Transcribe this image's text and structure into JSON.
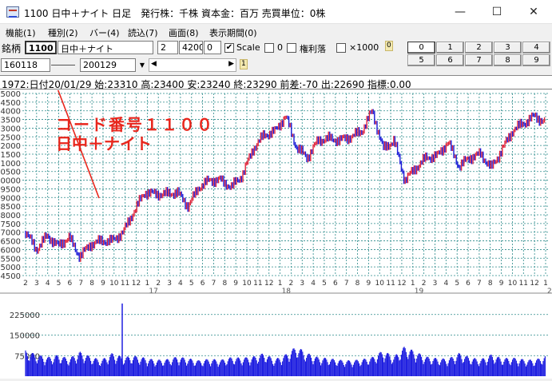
{
  "window": {
    "title": "1100 日中＋ナイト  日足　発行株：千株  資本金：百万  売買単位：0株",
    "minimize": "—",
    "maximize": "☐",
    "close": "✕"
  },
  "menu": [
    {
      "label": "機能(1)"
    },
    {
      "label": "種別(2)"
    },
    {
      "label": "バー(4)"
    },
    {
      "label": "読込(7)"
    },
    {
      "label": "画面(8)"
    },
    {
      "label": "表示期間(0)"
    }
  ],
  "toolbar": {
    "symbol_label": "銘柄",
    "code": "1100",
    "name": "日中＋ナイト",
    "field1": "2",
    "field2": "4200",
    "field3": "0",
    "scale_checked": "✔",
    "scale_label": "Scale",
    "zero_label": "0",
    "kenri_label": "権利落",
    "x1000_label": "×1000",
    "badge0": "0",
    "badge1": "1",
    "date_from": "160118",
    "date_to": "200129",
    "grid_buttons": [
      "0",
      "1",
      "2",
      "3",
      "4",
      "5",
      "6",
      "7",
      "8",
      "9"
    ],
    "grid_active": "0"
  },
  "info": {
    "text": "1972:日付20/01/29 始:23310 高:23400 安:23240 終:23290 前差:-70 出:22690 指標:0.00"
  },
  "annotation": {
    "line1": "コード番号１１００",
    "line2": "日中＋ナイト",
    "color": "#e8261c"
  },
  "colors": {
    "up": "#e0243a",
    "down": "#1a1ad8",
    "grid": "#2a8a8a",
    "volume": "#1f1fe0"
  },
  "chart_data": {
    "type": "line",
    "title": "",
    "ylim": [
      14500,
      25000
    ],
    "yticks": [
      "25000",
      "24500",
      "24000",
      "23500",
      "23000",
      "22500",
      "22000",
      "21500",
      "21000",
      "20500",
      "20000",
      "19500",
      "19000",
      "18500",
      "18000",
      "17500",
      "17000",
      "16500",
      "16000",
      "15500",
      "15000",
      "14500"
    ],
    "month_ticks": [
      "2",
      "3",
      "4",
      "5",
      "6",
      "7",
      "8",
      "9",
      "10",
      "11",
      "12",
      "1",
      "2",
      "3",
      "4",
      "5",
      "6",
      "7",
      "8",
      "9",
      "10",
      "11",
      "12",
      "1",
      "2",
      "3",
      "4",
      "5",
      "6",
      "7",
      "8",
      "9",
      "10",
      "11",
      "12",
      "1",
      "2",
      "3",
      "4",
      "5",
      "6",
      "7",
      "8",
      "9",
      "10",
      "11",
      "12",
      "1"
    ],
    "year_labels": [
      "17",
      "18",
      "19",
      "20"
    ],
    "x": [
      "2016-01",
      "2016-02",
      "2016-03",
      "2016-04",
      "2016-05",
      "2016-06",
      "2016-07",
      "2016-08",
      "2016-09",
      "2016-10",
      "2016-11",
      "2016-12",
      "2017-01",
      "2017-02",
      "2017-03",
      "2017-04",
      "2017-05",
      "2017-06",
      "2017-07",
      "2017-08",
      "2017-09",
      "2017-10",
      "2017-11",
      "2017-12",
      "2018-01",
      "2018-02",
      "2018-03",
      "2018-04",
      "2018-05",
      "2018-06",
      "2018-07",
      "2018-08",
      "2018-09",
      "2018-10",
      "2018-11",
      "2018-12",
      "2019-01",
      "2019-02",
      "2019-03",
      "2019-04",
      "2019-05",
      "2019-06",
      "2019-07",
      "2019-08",
      "2019-09",
      "2019-10",
      "2019-11",
      "2019-12",
      "2020-01"
    ],
    "series": [
      {
        "values": [
          17000,
          16000,
          16800,
          16200,
          16700,
          15600,
          16300,
          16500,
          16500,
          17000,
          18200,
          19300,
          19200,
          19200,
          19300,
          18500,
          19600,
          20000,
          20000,
          19600,
          20300,
          21800,
          22600,
          22800,
          23700,
          21900,
          21300,
          22300,
          22400,
          22300,
          22500,
          22800,
          24000,
          21800,
          22300,
          20000,
          20700,
          21300,
          21400,
          22200,
          20800,
          21300,
          21500,
          20700,
          21800,
          22900,
          23300,
          23700,
          23300
        ]
      }
    ],
    "volume": {
      "ylim": [
        0,
        300000
      ],
      "yticks": [
        "225000",
        "150000",
        "75000"
      ],
      "values": [
        95000,
        80000,
        70000,
        78000,
        65000,
        90000,
        72000,
        60000,
        85000,
        70000,
        75000,
        68000,
        60000,
        62000,
        72000,
        66000,
        58000,
        64000,
        60000,
        70000,
        68000,
        72000,
        85000,
        62000,
        80000,
        110000,
        85000,
        70000,
        66000,
        60000,
        58000,
        62000,
        70000,
        95000,
        72000,
        110000,
        90000,
        72000,
        66000,
        64000,
        85000,
        70000,
        62000,
        80000,
        66000,
        68000,
        62000,
        60000,
        75000
      ]
    }
  }
}
